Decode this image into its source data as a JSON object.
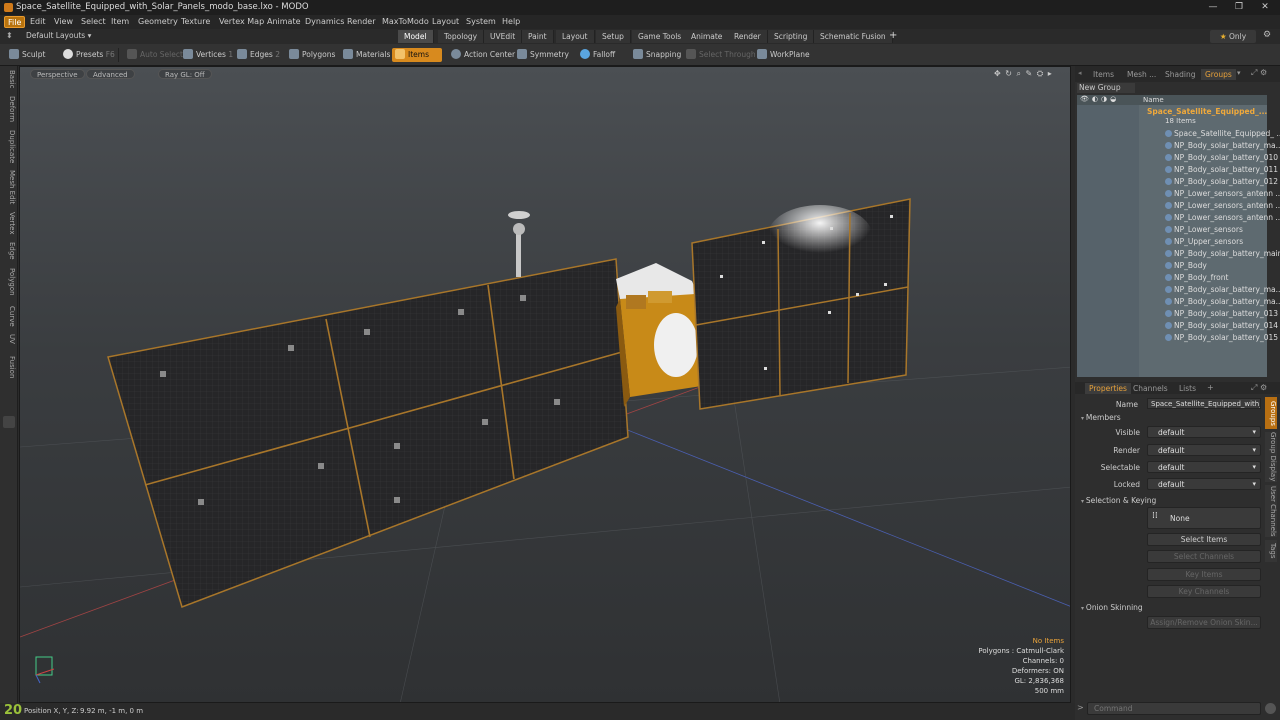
{
  "window": {
    "title": "Space_Satellite_Equipped_with_Solar_Panels_modo_base.lxo - MODO",
    "controls": [
      "—",
      "❐",
      "✕"
    ]
  },
  "menu": [
    "File",
    "Edit",
    "View",
    "Select",
    "Item",
    "Geometry",
    "Texture",
    "Vertex Map",
    "Animate",
    "Dynamics",
    "Render",
    "MaxToModo",
    "Layout",
    "System",
    "Help"
  ],
  "layouts": {
    "selector": "Default Layouts",
    "tabs": [
      "Model",
      "Topology",
      "UVEdit",
      "Paint",
      "Layout",
      "Setup",
      "Game Tools",
      "Animate",
      "Render",
      "Scripting",
      "Schematic Fusion"
    ],
    "active": "Model",
    "add": "+",
    "only": "Only"
  },
  "toolbar": {
    "sculpt": "Sculpt",
    "presets": "Presets",
    "presets_key": "F6",
    "auto_select": "Auto Select",
    "vertices": "Vertices",
    "vertices_key": "1",
    "edges": "Edges",
    "edges_key": "2",
    "polygons": "Polygons",
    "materials": "Materials",
    "items": "Items",
    "action_center": "Action Center",
    "symmetry": "Symmetry",
    "falloff": "Falloff",
    "snapping": "Snapping",
    "select_through": "Select Through",
    "workplane": "WorkPlane"
  },
  "left_tabs": [
    "Basic",
    "Deform",
    "Duplicate",
    "Mesh Edit",
    "Vertex",
    "Edge",
    "Polygon",
    "Curve",
    "UV",
    "Fusion"
  ],
  "viewport": {
    "view": "Perspective",
    "shading": "Advanced",
    "raygl": "Ray GL: Off",
    "stats": {
      "selection": "No Items",
      "polygons": "Polygons : Catmull-Clark",
      "channels": "Channels: 0",
      "deformers": "Deformers: ON",
      "gl": "GL: 2,836,368",
      "scale": "500 mm"
    }
  },
  "status": {
    "frame": "20",
    "position_label": "Position X, Y, Z:",
    "position_value": "9.92 m, -1 m, 0 m"
  },
  "groups_panel": {
    "tabs": [
      "Items",
      "Mesh ...",
      "Shading",
      "Groups"
    ],
    "active": "Groups",
    "new_group": "New Group",
    "column_name": "Name",
    "group_name": "Space_Satellite_Equipped_...",
    "group_count": "18 Items",
    "items": [
      "Space_Satellite_Equipped_ ...",
      "NP_Body_solar_battery_ma...",
      "NP_Body_solar_battery_010",
      "NP_Body_solar_battery_011",
      "NP_Body_solar_battery_012",
      "NP_Lower_sensors_antenn ...",
      "NP_Lower_sensors_antenn ...",
      "NP_Lower_sensors_antenn ...",
      "NP_Lower_sensors",
      "NP_Upper_sensors",
      "NP_Body_solar_battery_main",
      "NP_Body",
      "NP_Body_front",
      "NP_Body_solar_battery_ma...",
      "NP_Body_solar_battery_ma...",
      "NP_Body_solar_battery_013",
      "NP_Body_solar_battery_014",
      "NP_Body_solar_battery_015"
    ]
  },
  "properties_panel": {
    "tabs": [
      "Properties",
      "Channels",
      "Lists"
    ],
    "active": "Properties",
    "add": "+",
    "name_label": "Name",
    "name_value": "Space_Satellite_Equipped_with_S",
    "members": "Members",
    "visible_label": "Visible",
    "visible_value": "default",
    "render_label": "Render",
    "render_value": "default",
    "selectable_label": "Selectable",
    "selectable_value": "default",
    "locked_label": "Locked",
    "locked_value": "default",
    "selection_keying": "Selection & Keying",
    "none": "None",
    "select_items": "Select Items",
    "select_channels": "Select Channels",
    "key_items": "Key Items",
    "key_channels": "Key Channels",
    "onion_skinning": "Onion Skinning",
    "assign_onion": "Assign/Remove Onion Skin...",
    "side_tabs": [
      "Groups",
      "Group Display",
      "User Channels",
      "Tags"
    ]
  },
  "command": {
    "placeholder": "Command"
  }
}
